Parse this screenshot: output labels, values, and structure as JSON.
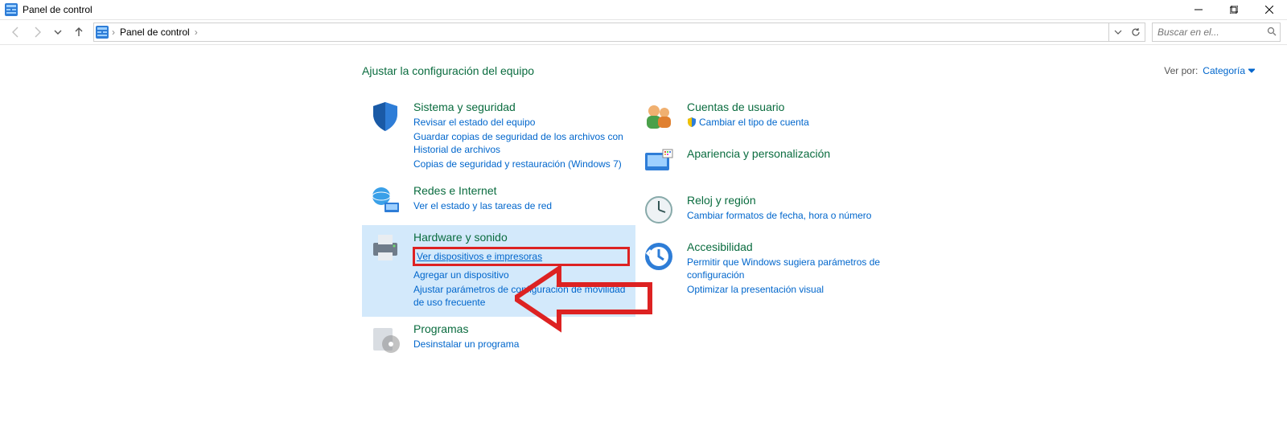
{
  "window": {
    "title": "Panel de control"
  },
  "nav": {
    "breadcrumb_root": "Panel de control",
    "search_placeholder": "Buscar en el..."
  },
  "page": {
    "heading": "Ajustar la configuración del equipo",
    "view_by_label": "Ver por:",
    "view_by_value": "Categoría"
  },
  "left_col": [
    {
      "id": "system-security",
      "title": "Sistema y seguridad",
      "links": [
        "Revisar el estado del equipo",
        "Guardar copias de seguridad de los archivos con Historial de archivos",
        "Copias de seguridad y restauración (Windows 7)"
      ]
    },
    {
      "id": "network-internet",
      "title": "Redes e Internet",
      "links": [
        "Ver el estado y las tareas de red"
      ]
    },
    {
      "id": "hardware-sound",
      "title": "Hardware y sonido",
      "highlight": true,
      "links": [
        "Ver dispositivos e impresoras",
        "Agregar un dispositivo",
        "Ajustar parámetros de configuración de movilidad de uso frecuente"
      ],
      "boxed_link_index": 0
    },
    {
      "id": "programs",
      "title": "Programas",
      "links": [
        "Desinstalar un programa"
      ]
    }
  ],
  "right_col": [
    {
      "id": "user-accounts",
      "title": "Cuentas de usuario",
      "links": [
        "Cambiar el tipo de cuenta"
      ],
      "shield_link_index": 0
    },
    {
      "id": "appearance",
      "title": "Apariencia y personalización",
      "links": []
    },
    {
      "id": "clock-region",
      "title": "Reloj y región",
      "links": [
        "Cambiar formatos de fecha, hora o número"
      ]
    },
    {
      "id": "accessibility",
      "title": "Accesibilidad",
      "links": [
        "Permitir que Windows sugiera parámetros de configuración",
        "Optimizar la presentación visual"
      ]
    }
  ]
}
